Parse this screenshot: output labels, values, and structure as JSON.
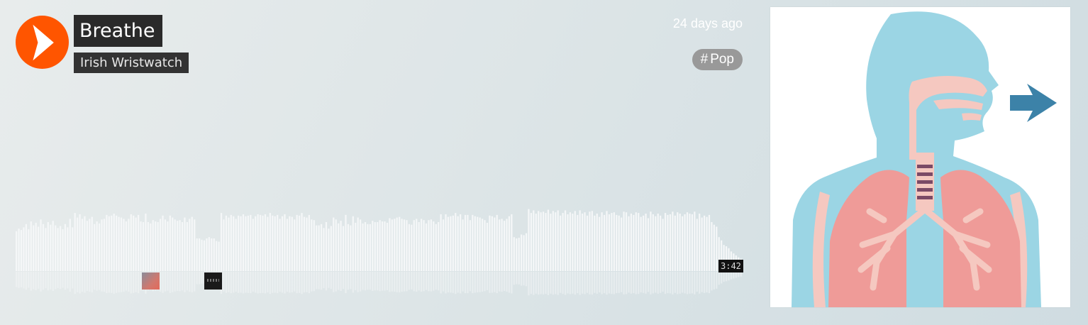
{
  "track": {
    "title": "Breathe",
    "artist": "Irish Wristwatch",
    "posted": "24 days ago",
    "tag": "Pop",
    "duration": "3:42"
  },
  "colors": {
    "play_button": "#ff5500",
    "waveform": "#f5f7f8",
    "tag_bg": "#999999"
  },
  "icons": {
    "play": "play-icon",
    "tag": "hash-icon"
  },
  "waveform_levels": [
    0.61,
    0.65,
    0.63,
    0.67,
    0.72,
    0.64,
    0.76,
    0.7,
    0.74,
    0.68,
    0.79,
    0.72,
    0.66,
    0.75,
    0.71,
    0.77,
    0.7,
    0.66,
    0.69,
    0.64,
    0.72,
    0.67,
    0.8,
    0.67,
    0.89,
    0.82,
    0.87,
    0.8,
    0.84,
    0.77,
    0.8,
    0.83,
    0.72,
    0.76,
    0.73,
    0.79,
    0.8,
    0.86,
    0.84,
    0.85,
    0.88,
    0.85,
    0.83,
    0.82,
    0.8,
    0.76,
    0.8,
    0.87,
    0.85,
    0.82,
    0.86,
    0.76,
    0.75,
    0.88,
    0.75,
    0.73,
    0.78,
    0.76,
    0.75,
    0.8,
    0.85,
    0.79,
    0.76,
    0.85,
    0.82,
    0.79,
    0.77,
    0.78,
    0.75,
    0.82,
    0.75,
    0.8,
    0.83,
    0.79,
    0.5,
    0.5,
    0.48,
    0.47,
    0.5,
    0.52,
    0.5,
    0.5,
    0.46,
    0.45,
    0.89,
    0.79,
    0.85,
    0.82,
    0.86,
    0.84,
    0.8,
    0.85,
    0.84,
    0.87,
    0.84,
    0.85,
    0.86,
    0.8,
    0.84,
    0.87,
    0.86,
    0.85,
    0.87,
    0.83,
    0.89,
    0.85,
    0.84,
    0.86,
    0.8,
    0.84,
    0.87,
    0.8,
    0.84,
    0.83,
    0.79,
    0.86,
    0.85,
    0.89,
    0.83,
    0.82,
    0.86,
    0.79,
    0.78,
    0.7,
    0.7,
    0.72,
    0.66,
    0.75,
    0.65,
    0.69,
    0.82,
    0.79,
    0.73,
    0.77,
    0.69,
    0.86,
    0.72,
    0.7,
    0.84,
    0.74,
    0.82,
    0.79,
    0.73,
    0.75,
    0.72,
    0.72,
    0.77,
    0.75,
    0.75,
    0.78,
    0.76,
    0.76,
    0.74,
    0.81,
    0.79,
    0.8,
    0.82,
    0.83,
    0.8,
    0.79,
    0.78,
    0.72,
    0.71,
    0.78,
    0.8,
    0.75,
    0.8,
    0.78,
    0.73,
    0.78,
    0.79,
    0.76,
    0.72,
    0.75,
    0.87,
    0.79,
    0.87,
    0.83,
    0.84,
    0.85,
    0.89,
    0.84,
    0.87,
    0.79,
    0.86,
    0.86,
    0.78,
    0.86,
    0.84,
    0.83,
    0.82,
    0.8,
    0.78,
    0.74,
    0.85,
    0.84,
    0.82,
    0.86,
    0.79,
    0.8,
    0.77,
    0.8,
    0.84,
    0.87,
    0.52,
    0.5,
    0.51,
    0.56,
    0.55,
    0.58,
    0.95,
    0.89,
    0.93,
    0.88,
    0.92,
    0.9,
    0.91,
    0.89,
    0.94,
    0.88,
    0.92,
    0.9,
    0.93,
    0.85,
    0.89,
    0.93,
    0.87,
    0.9,
    0.88,
    0.92,
    0.86,
    0.93,
    0.88,
    0.9,
    0.85,
    0.91,
    0.92,
    0.85,
    0.88,
    0.83,
    0.9,
    0.86,
    0.92,
    0.87,
    0.89,
    0.9,
    0.86,
    0.85,
    0.82,
    0.91,
    0.9,
    0.84,
    0.88,
    0.86,
    0.9,
    0.89,
    0.83,
    0.85,
    0.88,
    0.81,
    0.91,
    0.87,
    0.84,
    0.88,
    0.85,
    0.8,
    0.89,
    0.86,
    0.87,
    0.91,
    0.85,
    0.9,
    0.88,
    0.84,
    0.87,
    0.9,
    0.88,
    0.87,
    0.91,
    0.8,
    0.88,
    0.82,
    0.85,
    0.83,
    0.86,
    0.75,
    0.71,
    0.68,
    0.52,
    0.47,
    0.4,
    0.38,
    0.35,
    0.3,
    0.27,
    0.24,
    0.21,
    0.19
  ]
}
